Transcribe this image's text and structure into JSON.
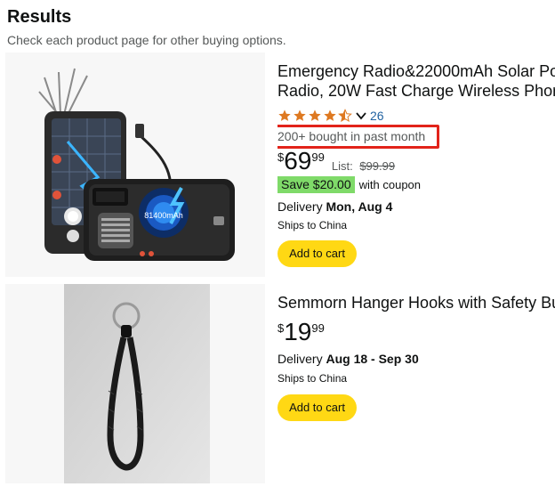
{
  "header": {
    "title": "Results",
    "subtitle": "Check each product page for other buying options."
  },
  "products": [
    {
      "title_line1": "Emergency Radio&22000mAh Solar Po",
      "title_line2": "Radio, 20W Fast Charge Wireless Phor",
      "rating_stars": 4.5,
      "rating_count": "26",
      "bought": "200+ bought in past month",
      "price_symbol": "$",
      "price_whole": "69",
      "price_fraction": "99",
      "list_label": "List:",
      "list_price": "$99.99",
      "save_badge": "Save $20.00",
      "coupon_text": "with coupon",
      "delivery_label": "Delivery",
      "delivery_date": "Mon, Aug 4",
      "ships": "Ships to China",
      "cart_label": "Add to cart",
      "image_text": "81400mAh"
    },
    {
      "title_line1": "Semmorn Hanger Hooks with Safety Bu",
      "price_symbol": "$",
      "price_whole": "19",
      "price_fraction": "99",
      "delivery_label": "Delivery",
      "delivery_date": "Aug 18 - Sep 30",
      "ships": "Ships to China",
      "cart_label": "Add to cart"
    }
  ],
  "colors": {
    "star": "#de7921",
    "link": "#2162a1",
    "cart_button": "#ffd814",
    "save_badge": "#7fda69",
    "highlight_box": "#e2231a"
  },
  "icons": [
    "star-icon",
    "chevron-down-icon"
  ]
}
